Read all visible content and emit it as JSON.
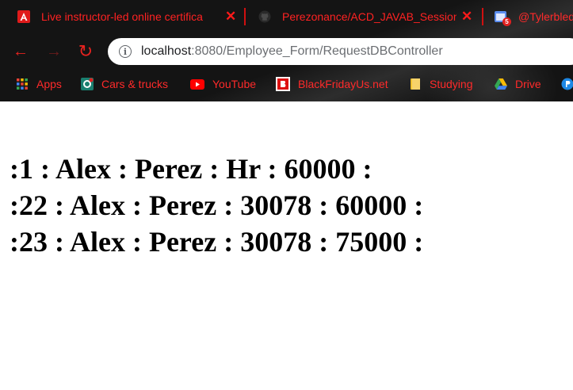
{
  "tabs": [
    {
      "title": "Live instructor-led online certifica",
      "icon": "adobe-icon"
    },
    {
      "title": "Perezonance/ACD_JAVAB_Session",
      "icon": "github-icon"
    },
    {
      "title": "@Tylerbled",
      "icon": "calendar-icon",
      "badge": "5"
    }
  ],
  "close_glyph": "✕",
  "toolbar": {
    "back_glyph": "←",
    "forward_glyph": "→",
    "reload_glyph": "↻",
    "info_glyph": "i",
    "url_host": "localhost",
    "url_path": ":8080/Employee_Form/RequestDBController"
  },
  "bookmarks": [
    {
      "label": "Apps",
      "icon": "apps-grid-icon"
    },
    {
      "label": "Cars & trucks",
      "icon": "cars-icon"
    },
    {
      "label": "YouTube",
      "icon": "youtube-icon"
    },
    {
      "label": "BlackFridayUs.net",
      "icon": "blackfriday-icon"
    },
    {
      "label": "Studying",
      "icon": "folder-icon"
    },
    {
      "label": "Drive",
      "icon": "google-drive-icon"
    }
  ],
  "content": {
    "lines": [
      ":1 : Alex : Perez : Hr : 60000 :",
      ":22 : Alex : Perez : 30078 : 60000 :",
      ":23 : Alex : Perez : 30078 : 75000 :"
    ]
  },
  "colors": {
    "accent": "#ff2222",
    "chrome_bg": "#141414"
  }
}
